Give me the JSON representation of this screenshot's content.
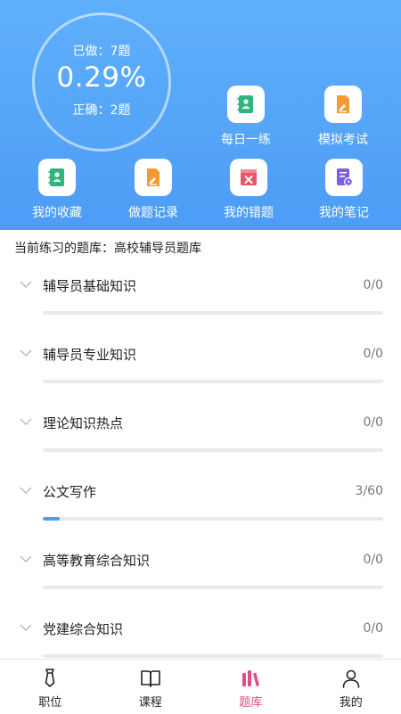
{
  "stats": {
    "done_text": "已做：7题",
    "accuracy_text": "0.29%",
    "correct_text": "正确：2题"
  },
  "actions": {
    "daily": {
      "label": "每日一练",
      "icon": "notebook-icon",
      "color": "#2fb67c"
    },
    "mock": {
      "label": "模拟考试",
      "icon": "exam-pencil-icon",
      "color": "#f39a33"
    },
    "favorites": {
      "label": "我的收藏",
      "icon": "favorite-book-icon",
      "color": "#2fb67c"
    },
    "records": {
      "label": "做题记录",
      "icon": "record-pencil-icon",
      "color": "#f39a33"
    },
    "mistakes": {
      "label": "我的错题",
      "icon": "wrong-book-icon",
      "color": "#e8556d"
    },
    "notes": {
      "label": "我的笔记",
      "icon": "note-clock-icon",
      "color": "#7b5fe0"
    }
  },
  "current_bank": "当前练习的题库：高校辅导员题库",
  "subjects": [
    {
      "name": "辅导员基础知识",
      "count": "0/0",
      "progress": 0
    },
    {
      "name": "辅导员专业知识",
      "count": "0/0",
      "progress": 0
    },
    {
      "name": "理论知识热点",
      "count": "0/0",
      "progress": 0
    },
    {
      "name": "公文写作",
      "count": "3/60",
      "progress": 0.05
    },
    {
      "name": "高等教育综合知识",
      "count": "0/0",
      "progress": 0
    },
    {
      "name": "党建综合知识",
      "count": "0/0",
      "progress": 0
    }
  ],
  "tabs": [
    {
      "label": "职位",
      "icon": "tie-icon"
    },
    {
      "label": "课程",
      "icon": "open-book-icon"
    },
    {
      "label": "题库",
      "icon": "question-bank-icon",
      "active": true
    },
    {
      "label": "我的",
      "icon": "person-icon"
    }
  ],
  "colors": {
    "hero": "#4d9cf6",
    "active_tab": "#e94a86"
  }
}
